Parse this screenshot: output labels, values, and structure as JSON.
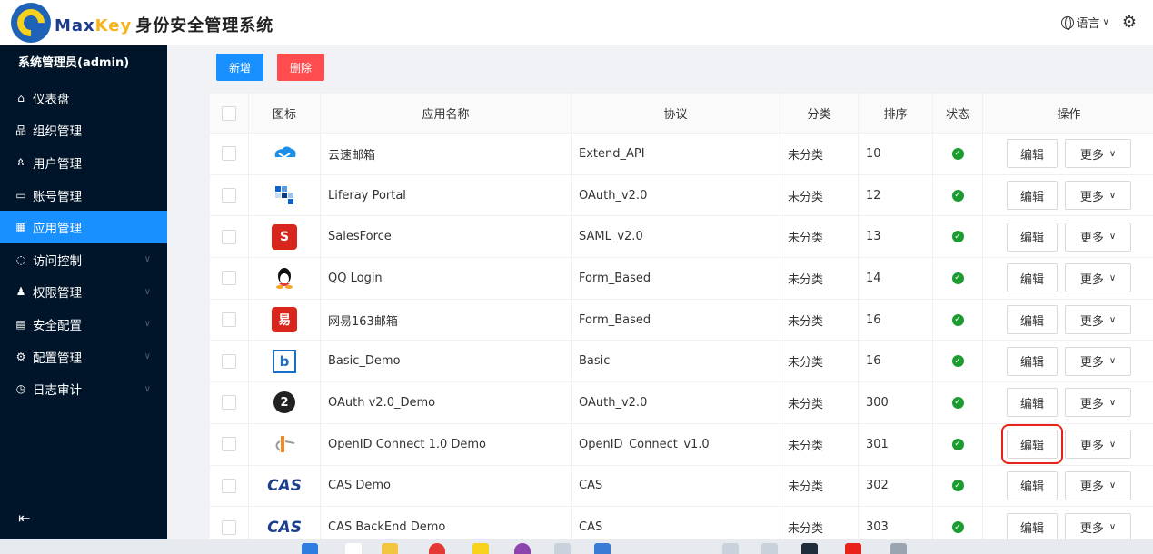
{
  "header": {
    "brand_max": "Max",
    "brand_key": "Key",
    "brand_title": "身份安全管理系统",
    "language_label": "语言",
    "settings_icon": "gear-icon"
  },
  "sidebar": {
    "user": "系统管理员(admin)",
    "items": [
      {
        "label": "仪表盘",
        "icon": "home-icon",
        "glyph": "⌂",
        "expandable": false,
        "active": false
      },
      {
        "label": "组织管理",
        "icon": "org-icon",
        "glyph": "品",
        "expandable": false,
        "active": false
      },
      {
        "label": "用户管理",
        "icon": "user-icon",
        "glyph": "ጰ",
        "expandable": false,
        "active": false
      },
      {
        "label": "账号管理",
        "icon": "idcard-icon",
        "glyph": "▭",
        "expandable": false,
        "active": false
      },
      {
        "label": "应用管理",
        "icon": "app-icon",
        "glyph": "▦",
        "expandable": false,
        "active": true
      },
      {
        "label": "访问控制",
        "icon": "shield-icon",
        "glyph": "◌",
        "expandable": true,
        "active": false
      },
      {
        "label": "权限管理",
        "icon": "permission-icon",
        "glyph": "♟",
        "expandable": true,
        "active": false
      },
      {
        "label": "安全配置",
        "icon": "security-icon",
        "glyph": "▤",
        "expandable": true,
        "active": false
      },
      {
        "label": "配置管理",
        "icon": "config-icon",
        "glyph": "⚙",
        "expandable": true,
        "active": false
      },
      {
        "label": "日志审计",
        "icon": "audit-icon",
        "glyph": "◷",
        "expandable": true,
        "active": false
      }
    ]
  },
  "toolbar": {
    "add_label": "新增",
    "delete_label": "删除"
  },
  "table": {
    "columns": [
      "图标",
      "应用名称",
      "协议",
      "分类",
      "排序",
      "状态",
      "操作"
    ],
    "edit_label": "编辑",
    "more_label": "更多",
    "rows": [
      {
        "icon": "cloud-mail-icon",
        "name": "云速邮箱",
        "protocol": "Extend_API",
        "category": "未分类",
        "sort": "10"
      },
      {
        "icon": "liferay-icon",
        "name": "Liferay Portal",
        "protocol": "OAuth_v2.0",
        "category": "未分类",
        "sort": "12"
      },
      {
        "icon": "salesforce-icon",
        "name": "SalesForce",
        "protocol": "SAML_v2.0",
        "category": "未分类",
        "sort": "13"
      },
      {
        "icon": "qq-icon",
        "name": "QQ Login",
        "protocol": "Form_Based",
        "category": "未分类",
        "sort": "14"
      },
      {
        "icon": "163-mail-icon",
        "name": "网易163邮箱",
        "protocol": "Form_Based",
        "category": "未分类",
        "sort": "16"
      },
      {
        "icon": "basic-demo-icon",
        "name": "Basic_Demo",
        "protocol": "Basic",
        "category": "未分类",
        "sort": "16"
      },
      {
        "icon": "oauth2-icon",
        "name": "OAuth v2.0_Demo",
        "protocol": "OAuth_v2.0",
        "category": "未分类",
        "sort": "300"
      },
      {
        "icon": "openid-icon",
        "name": "OpenID Connect 1.0 Demo",
        "protocol": "OpenID_Connect_v1.0",
        "category": "未分类",
        "sort": "301",
        "highlight_edit": true
      },
      {
        "icon": "cas-icon",
        "name": "CAS Demo",
        "protocol": "CAS",
        "category": "未分类",
        "sort": "302"
      },
      {
        "icon": "cas-icon",
        "name": "CAS BackEnd Demo",
        "protocol": "CAS",
        "category": "未分类",
        "sort": "303"
      }
    ]
  },
  "colors": {
    "sidebar_bg": "#001529",
    "accent": "#1890ff",
    "danger": "#ff4d4f",
    "status_ok": "#1a9c2e",
    "highlight": "#e8221b"
  }
}
